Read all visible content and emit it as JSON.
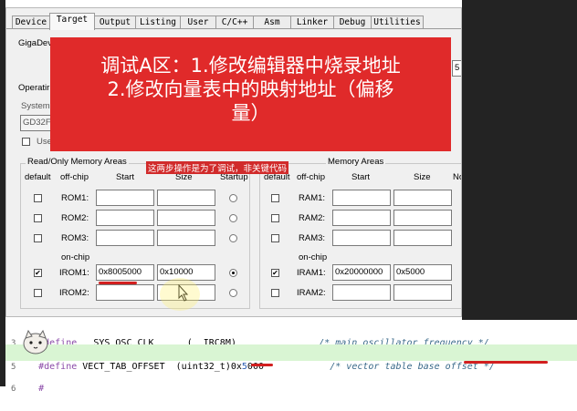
{
  "tabs": [
    "Device",
    "Target",
    "Output",
    "Listing",
    "User",
    "C/C++",
    "Asm",
    "Linker",
    "Debug",
    "Utilities"
  ],
  "active_tab": "Target",
  "device_label": "GigaDev",
  "right_value": "5",
  "operating_label": "Operatir",
  "system_label": "System",
  "system_value": "GD32F",
  "use_label": "Use",
  "rom_group": {
    "title": "Read/Only Memory Areas",
    "headers": {
      "default": "default",
      "offchip": "off-chip",
      "start": "Start",
      "size": "Size",
      "startup": "Startup"
    },
    "rows": [
      {
        "name": "ROM1:",
        "start": "",
        "size": "",
        "default": false,
        "startup": false
      },
      {
        "name": "ROM2:",
        "start": "",
        "size": "",
        "default": false,
        "startup": false
      },
      {
        "name": "ROM3:",
        "start": "",
        "size": "",
        "default": false,
        "startup": false
      },
      {
        "name": "IROM1:",
        "start": "0x8005000",
        "size": "0x10000",
        "default": true,
        "startup": true
      },
      {
        "name": "IROM2:",
        "start": "",
        "size": "",
        "default": false,
        "startup": false
      }
    ],
    "onchip": "on-chip"
  },
  "ram_group": {
    "title": "Read/Write Memory Areas",
    "title_visible": "Memory Areas",
    "headers": {
      "default": "default",
      "offchip": "off-chip",
      "start": "Start",
      "size": "Size",
      "noinit": "No"
    },
    "rows": [
      {
        "name": "RAM1:",
        "start": "",
        "size": "",
        "default": false
      },
      {
        "name": "RAM2:",
        "start": "",
        "size": "",
        "default": false
      },
      {
        "name": "RAM3:",
        "start": "",
        "size": "",
        "default": false
      },
      {
        "name": "IRAM1:",
        "start": "0x20000000",
        "size": "0x5000",
        "default": true
      },
      {
        "name": "IRAM2:",
        "start": "",
        "size": "",
        "default": false
      }
    ],
    "onchip": "on-chip"
  },
  "banner": {
    "line1": "调试A区：1.修改编辑器中烧录地址",
    "line2": "2.修改向量表中的映射地址（偏移",
    "line3": "量）"
  },
  "note": "这两步操作是为了调试，非关键代码",
  "code": [
    {
      "num": "3",
      "directive": "#define",
      "name": "__SYS_OSC_CLK",
      "value": "(__IRC8M)",
      "comment": "/* main oscillator frequency */"
    },
    {
      "num": "5",
      "directive": "#define",
      "name": "VECT_TAB_OFFSET",
      "value_prefix": "(uint32_t)0x",
      "value_hi": "5",
      "value_rest": "000",
      "comment": "/* vector table base offset */"
    },
    {
      "num": "6",
      "directive": "#",
      "name": "",
      "value": "",
      "comment": ""
    }
  ],
  "colors": {
    "banner": "#e02a2a",
    "highlight_line": "#d9f5d3",
    "mark": "#d21f1f"
  }
}
